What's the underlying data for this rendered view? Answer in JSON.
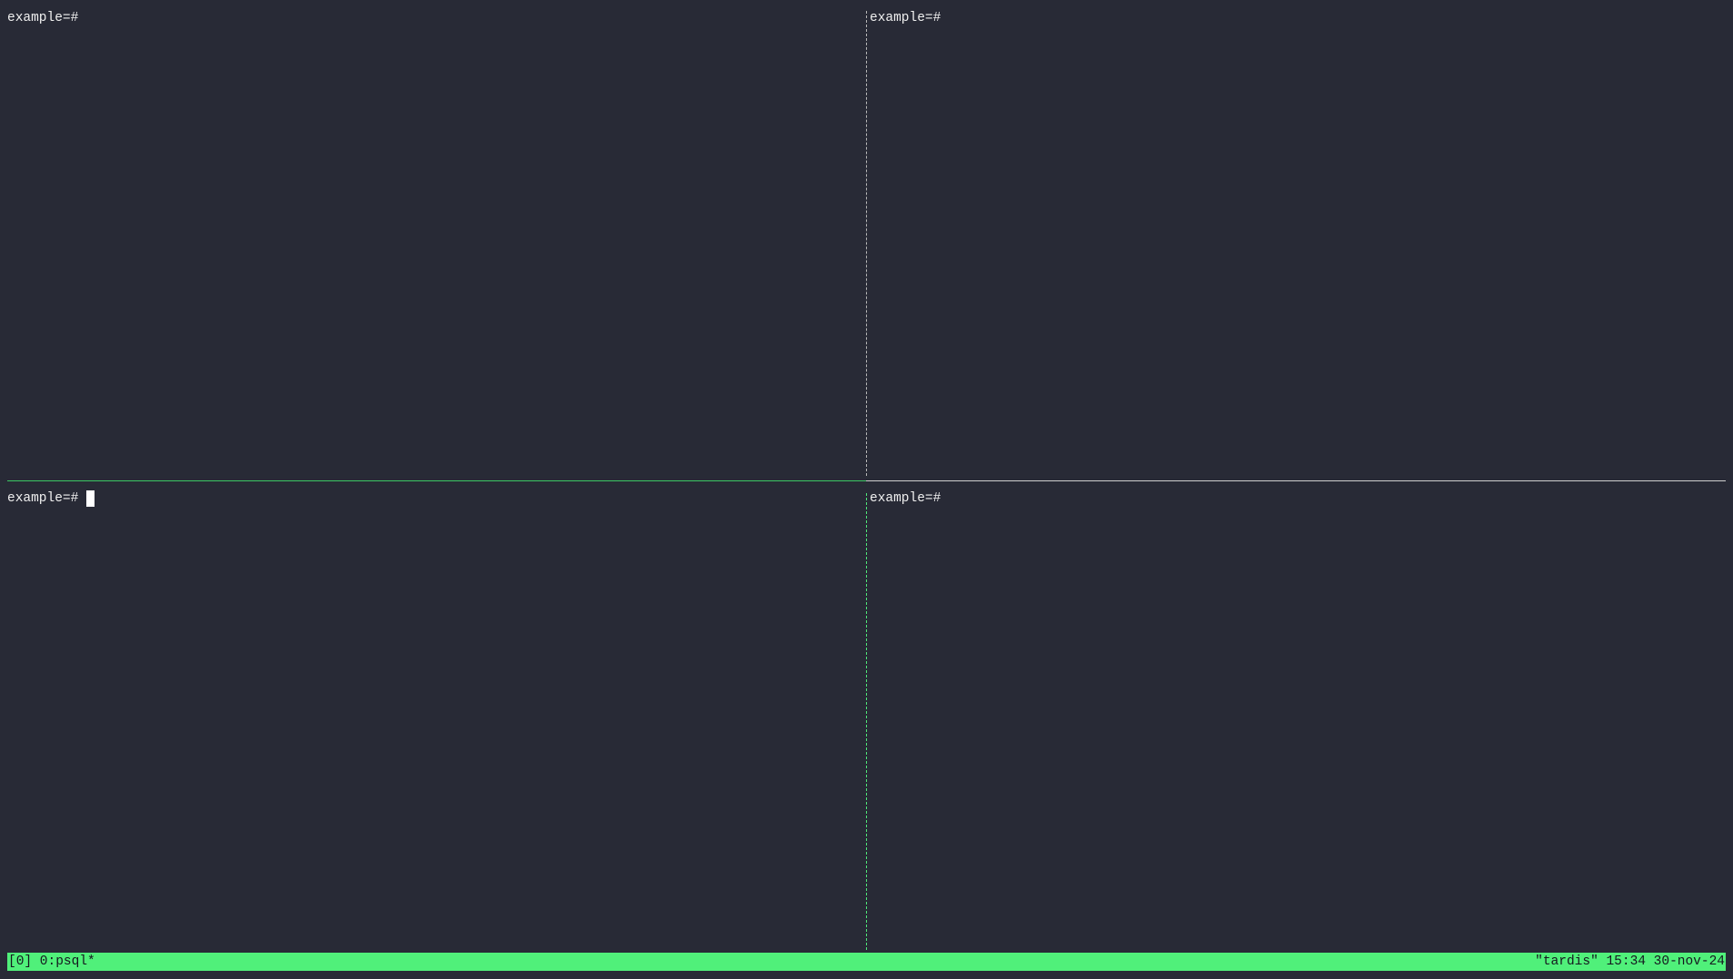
{
  "panes": {
    "top_left": {
      "prompt": "example=#"
    },
    "top_right": {
      "prompt": "example=#"
    },
    "bottom_left": {
      "prompt": "example=#",
      "active": true
    },
    "bottom_right": {
      "prompt": "example=#"
    }
  },
  "status_bar": {
    "left": "[0] 0:psql*",
    "right": "\"tardis\" 15:34 30-nov-24"
  },
  "colors": {
    "background": "#282a36",
    "status_bar_bg": "#50f07a",
    "active_border": "#50e97a",
    "inactive_border": "#cfcfcf",
    "text": "#f0f0f0"
  }
}
